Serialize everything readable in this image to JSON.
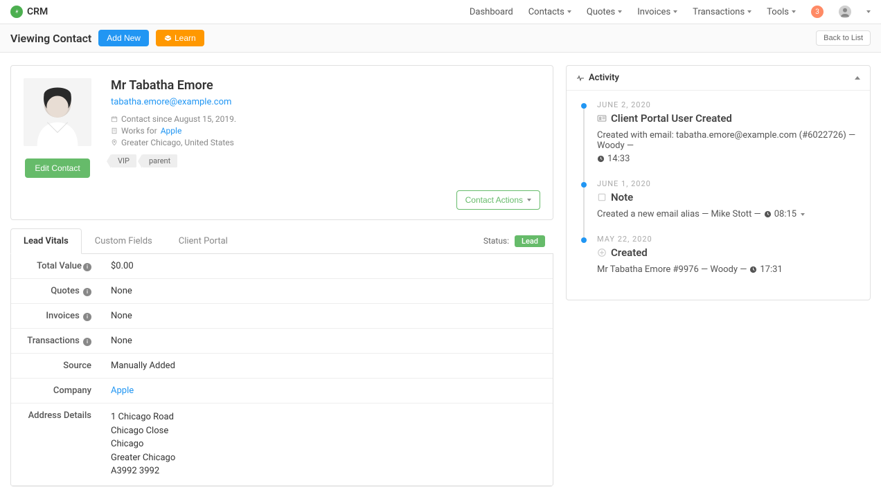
{
  "brand": "CRM",
  "nav": {
    "dashboard": "Dashboard",
    "contacts": "Contacts",
    "quotes": "Quotes",
    "invoices": "Invoices",
    "transactions": "Transactions",
    "tools": "Tools",
    "notif_count": "3"
  },
  "subbar": {
    "title": "Viewing Contact",
    "add_new": "Add New",
    "learn": "Learn",
    "back": "Back to List"
  },
  "contact": {
    "name": "Mr Tabatha Emore",
    "email": "tabatha.emore@example.com",
    "since": "Contact since August 15, 2019.",
    "works_prefix": "Works for ",
    "works_company": "Apple",
    "location": "Greater Chicago, United States",
    "tag1": "VIP",
    "tag2": "parent",
    "edit": "Edit Contact",
    "actions": "Contact Actions"
  },
  "tabs": {
    "vitals": "Lead Vitals",
    "custom": "Custom Fields",
    "portal": "Client Portal",
    "status_label": "Status:",
    "status_value": "Lead"
  },
  "vitals": {
    "total_value_label": "Total Value",
    "total_value": "$0.00",
    "quotes_label": "Quotes",
    "quotes": "None",
    "invoices_label": "Invoices",
    "invoices": "None",
    "transactions_label": "Transactions",
    "transactions": "None",
    "source_label": "Source",
    "source": "Manually Added",
    "company_label": "Company",
    "company": "Apple",
    "address_label": "Address Details",
    "addr1": "1 Chicago Road",
    "addr2": "Chicago Close",
    "addr3": "Chicago",
    "addr4": "Greater Chicago",
    "addr5": "A3992 3992"
  },
  "activity": {
    "header": "Activity",
    "item1": {
      "date": "June 2, 2020",
      "title": "Client Portal User Created",
      "desc_prefix": "Created with email: tabatha.emore@example.com (#6022726) — Woody — ",
      "time": "14:33"
    },
    "item2": {
      "date": "June 1, 2020",
      "title": "Note",
      "desc_prefix": "Created a new email alias — Mike Stott — ",
      "time": "08:15"
    },
    "item3": {
      "date": "May 22, 2020",
      "title": "Created",
      "desc_prefix": "Mr Tabatha Emore #9976 — Woody — ",
      "time": "17:31"
    }
  }
}
